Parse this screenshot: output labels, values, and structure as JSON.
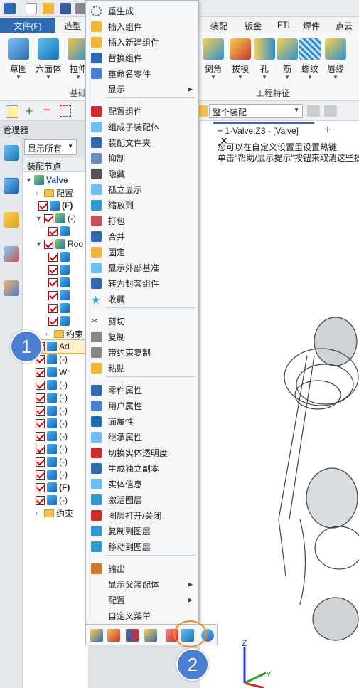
{
  "ribbon": {
    "file_tab": "文件(F)",
    "tabs": [
      "造型",
      "装配",
      "钣金",
      "FTI",
      "焊件",
      "点云"
    ],
    "left_buttons": [
      "草图",
      "六面体",
      "拉伸"
    ],
    "right_buttons": [
      "倒角",
      "拔模",
      "孔",
      "筋",
      "螺纹",
      "唇缘"
    ],
    "group_basic": "基础",
    "group_engineering": "工程特征"
  },
  "toolbar": {
    "assembly_select": "整个装配"
  },
  "manager": {
    "title": "管理器",
    "filter": "显示所有",
    "tree_header": "装配节点"
  },
  "tree": {
    "rows": [
      "Valve",
      "配置",
      "(F)",
      "(-)",
      "",
      "Roo",
      "",
      "",
      "",
      "",
      "",
      "",
      "约束",
      "Ad",
      "(-)",
      "Wr",
      "(-)",
      "(-)",
      "(-)",
      "(-)",
      "(-)",
      "(-)",
      "(-)",
      "(-)",
      "(F)",
      "(-)",
      "约束"
    ]
  },
  "document": {
    "tab_label": "1-Valve.Z3 - [Valve]",
    "hint_line1": "您可以在自定义设置里设置热键",
    "hint_line2": "单击\"帮助/显示提示\"按钮来取消这些提"
  },
  "context_menu": {
    "items": [
      {
        "label": "重生成",
        "icon": "regen-icon"
      },
      {
        "label": "插入组件",
        "icon": "insert-component-icon"
      },
      {
        "label": "插入新建组件",
        "icon": "insert-new-component-icon"
      },
      {
        "label": "替换组件",
        "icon": "replace-component-icon"
      },
      {
        "label": "重命名零件",
        "icon": "rename-part-icon"
      },
      {
        "label": "显示",
        "submenu": true
      },
      {
        "label": "配置组件",
        "icon": "config-component-icon"
      },
      {
        "label": "组成子装配体",
        "icon": "subassembly-icon"
      },
      {
        "label": "装配文件夹",
        "icon": "assembly-folder-icon"
      },
      {
        "label": "抑制",
        "icon": "suppress-icon"
      },
      {
        "label": "隐藏",
        "icon": "hide-icon"
      },
      {
        "label": "孤立显示",
        "icon": "isolate-icon"
      },
      {
        "label": "缩放到",
        "icon": "zoom-to-icon"
      },
      {
        "label": "打包",
        "icon": "pack-icon"
      },
      {
        "label": "合并",
        "icon": "merge-icon"
      },
      {
        "label": "固定",
        "icon": "fix-icon"
      },
      {
        "label": "显示外部基准",
        "icon": "external-datum-icon"
      },
      {
        "label": "转为封套组件",
        "icon": "envelope-icon"
      },
      {
        "label": "收藏",
        "icon": "star-icon"
      },
      {
        "label": "剪切",
        "icon": "cut-icon"
      },
      {
        "label": "复制",
        "icon": "copy-icon"
      },
      {
        "label": "带约束复制",
        "icon": "copy-with-constraints-icon"
      },
      {
        "label": "粘贴",
        "icon": "paste-icon"
      },
      {
        "label": "零件属性",
        "icon": "part-properties-icon"
      },
      {
        "label": "用户属性",
        "icon": "user-properties-icon"
      },
      {
        "label": "面属性",
        "icon": "face-properties-icon"
      },
      {
        "label": "继承属性",
        "icon": "inherit-properties-icon"
      },
      {
        "label": "切换实体透明度",
        "icon": "transparency-icon"
      },
      {
        "label": "生成独立副本",
        "icon": "independent-copy-icon"
      },
      {
        "label": "实体信息",
        "icon": "entity-info-icon"
      },
      {
        "label": "激活图层",
        "icon": "activate-layer-icon"
      },
      {
        "label": "图层打开/关闭",
        "icon": "layer-toggle-icon"
      },
      {
        "label": "复制到图层",
        "icon": "copy-to-layer-icon"
      },
      {
        "label": "移动到图层",
        "icon": "move-to-layer-icon"
      },
      {
        "label": "输出",
        "icon": "export-icon"
      },
      {
        "label": "显示父装配体",
        "submenu": true
      },
      {
        "label": "配置",
        "submenu": true
      },
      {
        "label": "自定义菜单"
      }
    ]
  },
  "callouts": {
    "one": "1",
    "two": "2"
  },
  "colors": {
    "accent": "#2e6ab1",
    "callout": "#4a7fd1",
    "highlight_ring": "#f08a1d",
    "check": "#cc0000"
  }
}
